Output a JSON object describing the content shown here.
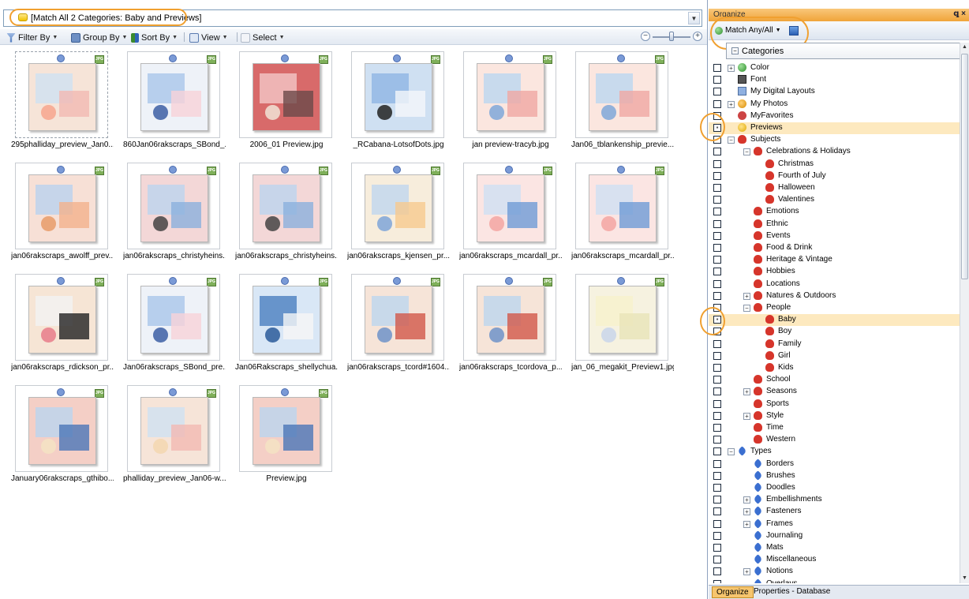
{
  "query": {
    "text": "[Match All 2 Categories: Baby and Previews]",
    "dropdown_icon": "chevron-down-icon"
  },
  "toolbar": {
    "filter_by": "Filter By",
    "group_by": "Group By",
    "sort_by": "Sort By",
    "view": "View",
    "select": "Select",
    "zoom_minus": "−",
    "zoom_plus": "+"
  },
  "thumbnails": [
    {
      "caption": "295phalliday_preview_Jan0...",
      "colors": [
        "#f6e4d8",
        "#cfe1f3",
        "#f3b9b3",
        "#f7a68e"
      ]
    },
    {
      "caption": "860Jan06rakscraps_SBond_...",
      "colors": [
        "#eef2f8",
        "#a9c6ea",
        "#f7d2d8",
        "#3c5fa5"
      ]
    },
    {
      "caption": "2006_01 Preview.jpg",
      "colors": [
        "#d86a6a",
        "#f4c7c7",
        "#6b4a4a",
        "#f1e3d6"
      ]
    },
    {
      "caption": "_RCabana-LotsofDots.jpg",
      "colors": [
        "#cfe0f2",
        "#8fb5e3",
        "#f4f6fa",
        "#222222"
      ]
    },
    {
      "caption": "jan preview-tracyb.jpg",
      "colors": [
        "#fbe6df",
        "#bcd7f0",
        "#f0a8a2",
        "#7fa7d9"
      ]
    },
    {
      "caption": "Jan06_tblankenship_previe...",
      "colors": [
        "#fbe6df",
        "#bcd7f0",
        "#f0a8a2",
        "#7fa7d9"
      ]
    },
    {
      "caption": "jan06rakscraps_awolff_prev...",
      "colors": [
        "#f7e0d6",
        "#b9d2ef",
        "#f2b28c",
        "#e79b68"
      ]
    },
    {
      "caption": "jan06rakscraps_christyheins...",
      "colors": [
        "#f3d7d7",
        "#bcd4ef",
        "#8bb0dd",
        "#444444"
      ]
    },
    {
      "caption": "jan06rakscraps_christyheins...",
      "colors": [
        "#f3d7d7",
        "#bcd4ef",
        "#8bb0dd",
        "#444444"
      ]
    },
    {
      "caption": "jan06rakscraps_kjensen_pr...",
      "colors": [
        "#f7eddc",
        "#bfd6ef",
        "#f6c98f",
        "#7fa4d8"
      ]
    },
    {
      "caption": "jan06rakscraps_mcardall_pr...",
      "colors": [
        "#fbe5e3",
        "#cfe0f3",
        "#6f9bd6",
        "#f3a6a2"
      ]
    },
    {
      "caption": "jan06rakscraps_mcardall_pr...",
      "colors": [
        "#fbe5e3",
        "#cfe0f3",
        "#6f9bd6",
        "#f3a6a2"
      ]
    },
    {
      "caption": "jan06rakscraps_rdickson_pr...",
      "colors": [
        "#f6e5d5",
        "#f3f3f3",
        "#222222",
        "#e77d8a"
      ]
    },
    {
      "caption": "Jan06rakscraps_SBond_pre...",
      "colors": [
        "#eef2f8",
        "#a9c6ea",
        "#f7d2d8",
        "#3c5fa5"
      ]
    },
    {
      "caption": "Jan06Rakscraps_shellychua...",
      "colors": [
        "#d9e7f6",
        "#4a7fc1",
        "#f6f6f6",
        "#2a5a9a"
      ]
    },
    {
      "caption": "jan06rakscraps_tcord#1604...",
      "colors": [
        "#f6e4d8",
        "#bdd6ef",
        "#d2574a",
        "#6f93c9"
      ]
    },
    {
      "caption": "jan06rakscraps_tcordova_p...",
      "colors": [
        "#f6e4d8",
        "#bdd6ef",
        "#d2574a",
        "#6f93c9"
      ]
    },
    {
      "caption": "jan_06_megakit_Preview1.jpg",
      "colors": [
        "#f6f2e0",
        "#f7f1cc",
        "#e9e3b8",
        "#c9d6ea"
      ]
    },
    {
      "caption": "January06rakscraps_gthibo...",
      "colors": [
        "#f4cfc6",
        "#bad4ef",
        "#4b76b8",
        "#f3e3c3"
      ]
    },
    {
      "caption": "phalliday_preview_Jan06-w...",
      "colors": [
        "#f6e4d8",
        "#cfe1f3",
        "#f3b9b3",
        "#f3d7b0"
      ]
    },
    {
      "caption": "Preview.jpg",
      "colors": [
        "#f4cfc6",
        "#bad4ef",
        "#4b76b8",
        "#f3e3c3"
      ]
    }
  ],
  "organize": {
    "title": "Organize",
    "close_controls": "ꝗ ×",
    "match_label": "Match Any/All",
    "categories_header": "Categories",
    "tree": [
      {
        "label": "Color",
        "level": 0,
        "expander": "+",
        "icon": "ball"
      },
      {
        "label": "Font",
        "level": 0,
        "expander": "",
        "icon": "doc"
      },
      {
        "label": "My Digital Layouts",
        "level": 0,
        "expander": "",
        "icon": "layout"
      },
      {
        "label": "My Photos",
        "level": 0,
        "expander": "+",
        "icon": "person"
      },
      {
        "label": "MyFavorites",
        "level": 0,
        "expander": "",
        "icon": "fav"
      },
      {
        "label": "Previews",
        "level": 0,
        "expander": "",
        "icon": "star",
        "checked": true,
        "highlight": true
      },
      {
        "label": "Subjects",
        "level": 0,
        "expander": "−",
        "icon": "heart"
      },
      {
        "label": "Celebrations & Holidays",
        "level": 1,
        "expander": "−",
        "icon": "heart"
      },
      {
        "label": "Christmas",
        "level": 2,
        "expander": "",
        "icon": "heart"
      },
      {
        "label": "Fourth of July",
        "level": 2,
        "expander": "",
        "icon": "heart"
      },
      {
        "label": "Halloween",
        "level": 2,
        "expander": "",
        "icon": "heart"
      },
      {
        "label": "Valentines",
        "level": 2,
        "expander": "",
        "icon": "heart"
      },
      {
        "label": "Emotions",
        "level": 1,
        "expander": "",
        "icon": "heart"
      },
      {
        "label": "Ethnic",
        "level": 1,
        "expander": "",
        "icon": "heart"
      },
      {
        "label": "Events",
        "level": 1,
        "expander": "",
        "icon": "heart"
      },
      {
        "label": "Food & Drink",
        "level": 1,
        "expander": "",
        "icon": "heart"
      },
      {
        "label": "Heritage & Vintage",
        "level": 1,
        "expander": "",
        "icon": "heart"
      },
      {
        "label": "Hobbies",
        "level": 1,
        "expander": "",
        "icon": "heart"
      },
      {
        "label": "Locations",
        "level": 1,
        "expander": "",
        "icon": "heart"
      },
      {
        "label": "Natures & Outdoors",
        "level": 1,
        "expander": "+",
        "icon": "heart"
      },
      {
        "label": "People",
        "level": 1,
        "expander": "−",
        "icon": "heart"
      },
      {
        "label": "Baby",
        "level": 2,
        "expander": "",
        "icon": "heart",
        "checked": true,
        "highlight": true
      },
      {
        "label": "Boy",
        "level": 2,
        "expander": "",
        "icon": "heart"
      },
      {
        "label": "Family",
        "level": 2,
        "expander": "",
        "icon": "heart"
      },
      {
        "label": "Girl",
        "level": 2,
        "expander": "",
        "icon": "heart"
      },
      {
        "label": "Kids",
        "level": 2,
        "expander": "",
        "icon": "heart"
      },
      {
        "label": "School",
        "level": 1,
        "expander": "",
        "icon": "heart"
      },
      {
        "label": "Seasons",
        "level": 1,
        "expander": "+",
        "icon": "heart"
      },
      {
        "label": "Sports",
        "level": 1,
        "expander": "",
        "icon": "heart"
      },
      {
        "label": "Style",
        "level": 1,
        "expander": "+",
        "icon": "heart"
      },
      {
        "label": "Time",
        "level": 1,
        "expander": "",
        "icon": "heart"
      },
      {
        "label": "Western",
        "level": 1,
        "expander": "",
        "icon": "heart"
      },
      {
        "label": "Types",
        "level": 0,
        "expander": "−",
        "icon": "tag"
      },
      {
        "label": "Borders",
        "level": 1,
        "expander": "",
        "icon": "tag"
      },
      {
        "label": "Brushes",
        "level": 1,
        "expander": "",
        "icon": "tag"
      },
      {
        "label": "Doodles",
        "level": 1,
        "expander": "",
        "icon": "tag"
      },
      {
        "label": "Embellishments",
        "level": 1,
        "expander": "+",
        "icon": "tag"
      },
      {
        "label": "Fasteners",
        "level": 1,
        "expander": "+",
        "icon": "tag"
      },
      {
        "label": "Frames",
        "level": 1,
        "expander": "+",
        "icon": "tag"
      },
      {
        "label": "Journaling",
        "level": 1,
        "expander": "",
        "icon": "tag"
      },
      {
        "label": "Mats",
        "level": 1,
        "expander": "",
        "icon": "tag"
      },
      {
        "label": "Miscellaneous",
        "level": 1,
        "expander": "",
        "icon": "tag"
      },
      {
        "label": "Notions",
        "level": 1,
        "expander": "+",
        "icon": "tag"
      },
      {
        "label": "Overlays",
        "level": 1,
        "expander": "",
        "icon": "tag"
      }
    ],
    "tabs": [
      "Organize",
      "Properties - Database"
    ]
  },
  "colors": {
    "accent_orange": "#f0a030",
    "highlight_row": "#fde9bf",
    "title_bar": "#f0a43a"
  }
}
